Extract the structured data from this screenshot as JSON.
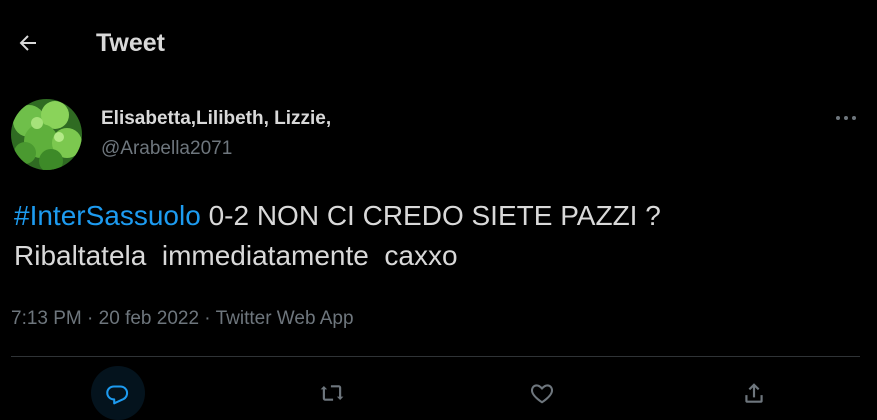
{
  "header": {
    "title": "Tweet"
  },
  "tweet": {
    "author": {
      "display_name": "Elisabetta,Lilibeth, Lizzie,",
      "handle": "@Arabella2071"
    },
    "hashtag": "#InterSassuolo",
    "text_line1_rest": " 0-2 NON CI CREDO SIETE PAZZI ?",
    "text_line2": "Ribaltatela  immediatamente  caxxo",
    "time": "7:13 PM",
    "separator": " · ",
    "date": "20 feb 2022",
    "source": "Twitter Web App"
  },
  "actions": [
    "reply-icon",
    "retweet-icon",
    "like-icon",
    "share-icon"
  ],
  "colors": {
    "background": "#000000",
    "text": "#d9d9d9",
    "secondary": "#6e767d",
    "accent": "#1d9bf0",
    "divider": "#2f3336"
  }
}
